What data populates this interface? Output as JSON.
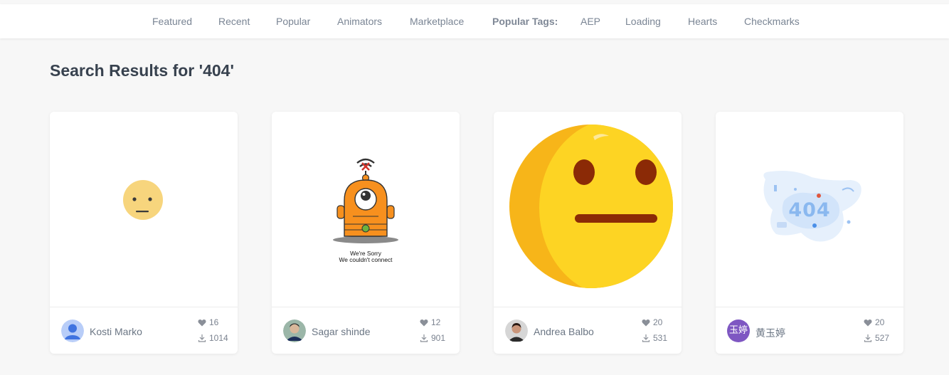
{
  "nav": {
    "items": [
      {
        "label": "Featured"
      },
      {
        "label": "Recent"
      },
      {
        "label": "Popular"
      },
      {
        "label": "Animators"
      },
      {
        "label": "Marketplace"
      }
    ],
    "tags_label": "Popular Tags:",
    "tags": [
      {
        "label": "AEP"
      },
      {
        "label": "Loading"
      },
      {
        "label": "Hearts"
      },
      {
        "label": "Checkmarks"
      }
    ]
  },
  "heading": "Search Results for '404'",
  "cards": [
    {
      "author": "Kosti Marko",
      "likes": "16",
      "downloads": "1014",
      "preview_icon": "neutral-face-small-icon"
    },
    {
      "author": "Sagar shinde",
      "likes": "12",
      "downloads": "901",
      "preview_icon": "robot-no-connection-icon",
      "preview_text": [
        "We're Sorry",
        "We couldn't connect"
      ]
    },
    {
      "author": "Andrea Balbo",
      "likes": "20",
      "downloads": "531",
      "preview_icon": "neutral-face-large-icon"
    },
    {
      "author": "黄玉婷",
      "avatar_text": "玉婷",
      "likes": "20",
      "downloads": "527",
      "preview_icon": "404-illustration-icon",
      "preview_text": [
        "404"
      ]
    }
  ],
  "colors": {
    "nav_text": "#7a8594",
    "heading": "#38424f",
    "face_yellow": "#fdd423",
    "face_shade": "#f7b519",
    "robot_orange": "#f7901e",
    "avatar_purple": "#7e57c2"
  }
}
